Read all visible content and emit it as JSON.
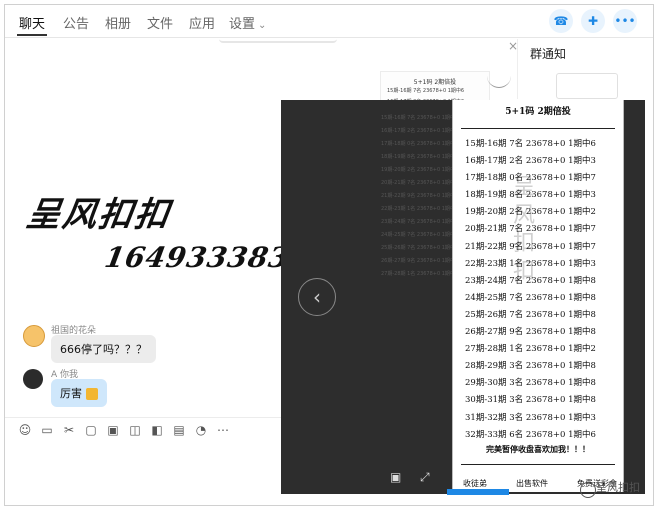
{
  "tabs": [
    {
      "label": "聊天",
      "active": true
    },
    {
      "label": "公告",
      "active": false
    },
    {
      "label": "相册",
      "active": false
    },
    {
      "label": "文件",
      "active": false
    },
    {
      "label": "应用",
      "active": false
    },
    {
      "label": "设置",
      "active": false
    }
  ],
  "notice": {
    "title": "群通知",
    "close": "×"
  },
  "banner": {
    "line1": "呈风扣扣",
    "line2": "164933383"
  },
  "messages": [
    {
      "sender": "祖国的花朵",
      "text": "666停了吗？？？"
    },
    {
      "sender": "A  你我",
      "text": "厉害"
    }
  ],
  "card": {
    "title": "5+1码    2期倍投",
    "rows": [
      "15期-16期 7名 23678+0 1期中6",
      "16期-17期 2名 23678+0 1期中3",
      "17期-18期 0名 23678+0 1期中7",
      "18期-19期 8名 23678+0 1期中3",
      "19期-20期 2名 23678+0 1期中2",
      "20期-21期 7名 23678+0 1期中7",
      "21期-22期 9名 23678+0 1期中7",
      "22期-23期 1名 23678+0 1期中3",
      "23期-24期 7名 23678+0 1期中8",
      "24期-25期 7名 23678+0 1期中8",
      "25期-26期 7名 23678+0 1期中8",
      "26期-27期 9名 23678+0 1期中8",
      "27期-28期 1名 23678+0 1期中2",
      "28期-29期 3名 23678+0 1期中8",
      "29期-30期 3名 23678+0 1期中8",
      "30期-31期 3名 23678+0 1期中8",
      "31期-32期 3名 23678+0 1期中3",
      "32期-33期 6名 23678+0 1期中6"
    ],
    "footer": "完美暂停收盘喜欢加我！！！",
    "links": [
      "收徒弟",
      "出售软件",
      "免费送彩金"
    ],
    "watermark": "呈风扣扣"
  },
  "brand_watermark": "呈风扣扣"
}
